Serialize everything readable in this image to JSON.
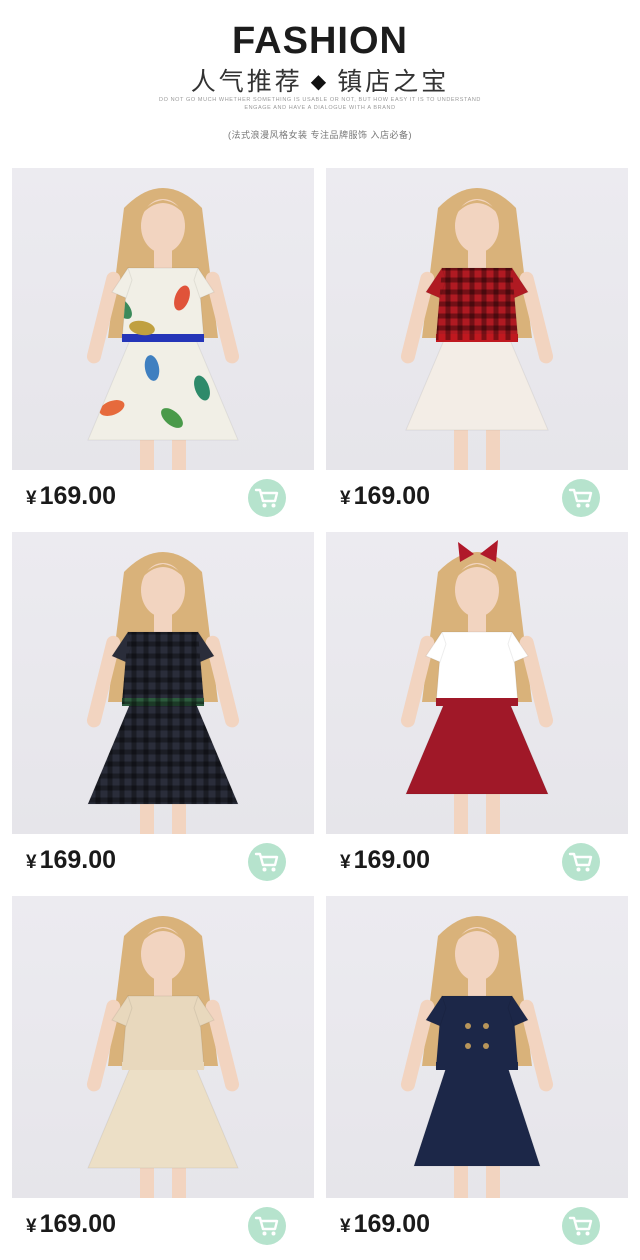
{
  "header": {
    "title": "FASHION",
    "subtitle_left": "人气推荐",
    "subtitle_diamond": "◆",
    "subtitle_right": "镇店之宝",
    "tagline": "DO NOT GO MUCH WHETHER SOMETHING IS USABLE OR NOT, BUT HOW EASY IT IS TO UNDERSTAND ENGAGE AND HAVE A DIALOGUE WITH A BRAND",
    "slogan": "(法式浪漫风格女装 专注品牌服饰 入店必备)"
  },
  "products": [
    {
      "price_symbol": "¥",
      "price": "169.00",
      "cart_icon": "shopping-cart-icon",
      "dress": "floral",
      "colors": {
        "top": "#f1efe6",
        "skirt": "#f1efe6",
        "sash": "#2535b8"
      }
    },
    {
      "price_symbol": "¥",
      "price": "169.00",
      "cart_icon": "shopping-cart-icon",
      "dress": "red-plaid-tulle",
      "colors": {
        "top": "#b01a22",
        "skirt": "#f3ede6",
        "sash": "#c0181f"
      }
    },
    {
      "price_symbol": "¥",
      "price": "169.00",
      "cart_icon": "shopping-cart-icon",
      "dress": "black-gingham",
      "colors": {
        "top": "#2a2d3a",
        "skirt": "#2a2d3a",
        "sash": "#2c5a3c"
      }
    },
    {
      "price_symbol": "¥",
      "price": "169.00",
      "cart_icon": "shopping-cart-icon",
      "dress": "white-top-red-tulle",
      "colors": {
        "top": "#ffffff",
        "skirt": "#a01828",
        "sash": "#a01828"
      }
    },
    {
      "price_symbol": "¥",
      "price": "169.00",
      "cart_icon": "shopping-cart-icon",
      "dress": "beige-two-piece",
      "colors": {
        "top": "#e8d8bd",
        "skirt": "#ecdfc6",
        "sash": "#e8d8bd"
      }
    },
    {
      "price_symbol": "¥",
      "price": "169.00",
      "cart_icon": "shopping-cart-icon",
      "dress": "navy-trench",
      "colors": {
        "top": "#1c2748",
        "skirt": "#1c2748",
        "sash": "#1c2748"
      }
    }
  ],
  "colors": {
    "cart_bg": "#b6e3cd",
    "cart_fg": "#ffffff",
    "hair": "#d9b27a",
    "skin": "#f2d4c0"
  }
}
